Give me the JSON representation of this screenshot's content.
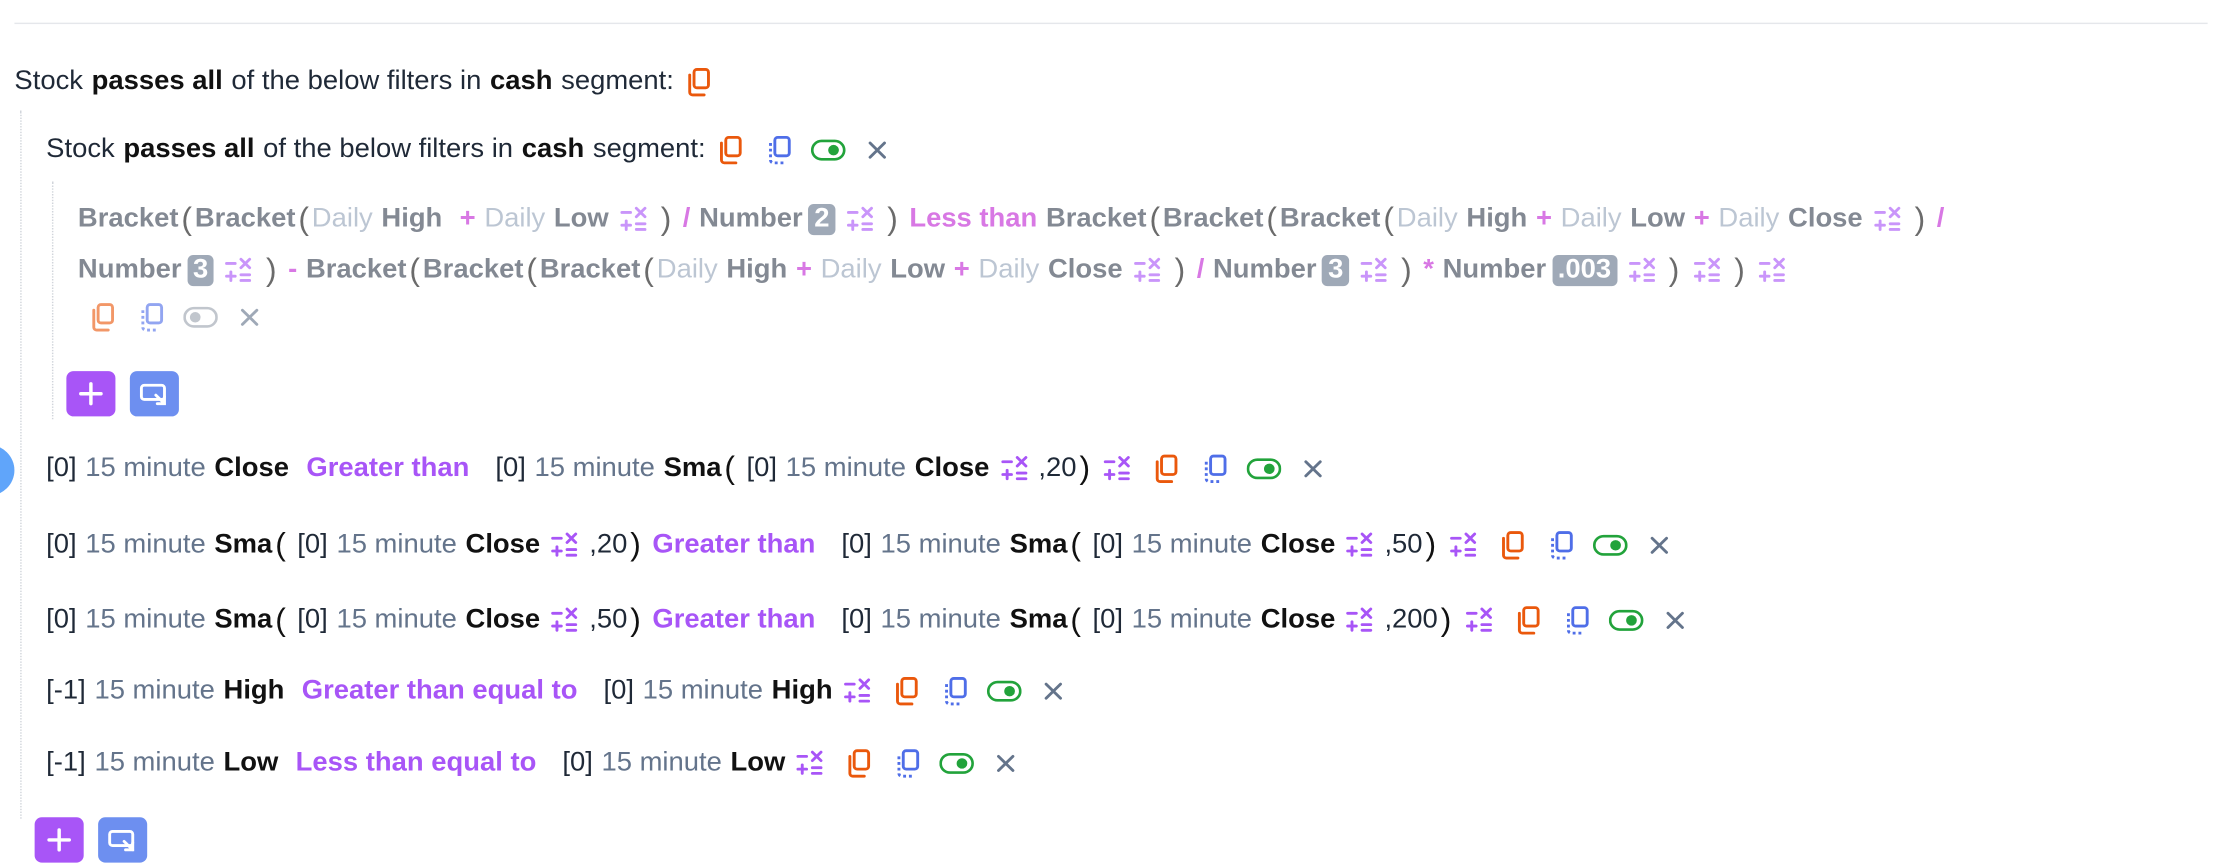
{
  "colors": {
    "accent": "#a855f7",
    "copy": "#ea580c",
    "duplicate": "#4f6ee8",
    "toggle": "#22a33b",
    "group_button": "#6d8ff0"
  },
  "icons": {
    "copy": "copy-icon",
    "duplicate": "duplicate-icon",
    "toggle": "toggle-icon",
    "close": "close-icon",
    "calc": "calculator-icon",
    "add": "plus-icon",
    "group": "add-group-icon"
  },
  "header": {
    "stock": "Stock",
    "passes_all": "passes all",
    "of_below": "of the below filters in",
    "cash": "cash",
    "segment": "segment:"
  },
  "nested": {
    "stock": "Stock",
    "passes_all": "passes all",
    "of_below": "of the below filters in",
    "cash": "cash",
    "segment": "segment:"
  },
  "expression": {
    "bracket": "Bracket",
    "daily": "Daily",
    "high": "High",
    "low": "Low",
    "close": "Close",
    "number": "Number",
    "plus": "+",
    "div": "/",
    "minus": "-",
    "mul": "*",
    "less_than": "Less than",
    "n2": "2",
    "n3a": "3",
    "n3b": "3",
    "n003": ".003"
  },
  "conditions": [
    {
      "l_idx": "[0]",
      "l_tf": "15 minute",
      "l_field": "Close",
      "op": "Greater than",
      "r_idx": "[0]",
      "r_tf": "15 minute",
      "r_fn": "Sma",
      "r_i_idx": "[0]",
      "r_i_tf": "15 minute",
      "r_i_field": "Close",
      "r_param": ",20"
    },
    {
      "l_idx": "[0]",
      "l_tf": "15 minute",
      "l_fn": "Sma",
      "l_i_idx": "[0]",
      "l_i_tf": "15 minute",
      "l_i_field": "Close",
      "l_param": ",20",
      "op": "Greater than",
      "r_idx": "[0]",
      "r_tf": "15 minute",
      "r_fn": "Sma",
      "r_i_idx": "[0]",
      "r_i_tf": "15 minute",
      "r_i_field": "Close",
      "r_param": ",50"
    },
    {
      "l_idx": "[0]",
      "l_tf": "15 minute",
      "l_fn": "Sma",
      "l_i_idx": "[0]",
      "l_i_tf": "15 minute",
      "l_i_field": "Close",
      "l_param": ",50",
      "op": "Greater than",
      "r_idx": "[0]",
      "r_tf": "15 minute",
      "r_fn": "Sma",
      "r_i_idx": "[0]",
      "r_i_tf": "15 minute",
      "r_i_field": "Close",
      "r_param": ",200"
    },
    {
      "l_idx": "[-1]",
      "l_tf": "15 minute",
      "l_field": "High",
      "op": "Greater than equal to",
      "r_idx": "[0]",
      "r_tf": "15 minute",
      "r_field": "High"
    },
    {
      "l_idx": "[-1]",
      "l_tf": "15 minute",
      "l_field": "Low",
      "op": "Less than equal to",
      "r_idx": "[0]",
      "r_tf": "15 minute",
      "r_field": "Low"
    }
  ]
}
